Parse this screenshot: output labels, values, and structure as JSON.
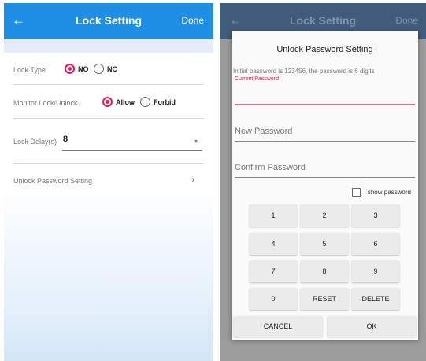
{
  "left_screen": {
    "appbar": {
      "back_icon": "arrow-left-icon",
      "back_glyph": "←",
      "title": "Lock Setting",
      "done_label": "Done",
      "color": "#1f8ee5"
    },
    "lock_type": {
      "label": "Lock Type",
      "options": [
        "NO",
        "NC"
      ],
      "selected": "NO"
    },
    "monitor": {
      "label": "Monitor Lock/Unlock",
      "options": [
        "Allow",
        "Forbid"
      ],
      "selected": "Allow"
    },
    "lock_delay": {
      "label": "Lock Delay(s)",
      "value": "8",
      "dropdown_glyph": "▾"
    },
    "unlock_password": {
      "label": "Unlock Password Setting",
      "chevron_glyph": "›"
    }
  },
  "right_screen": {
    "appbar": {
      "back_glyph": "←",
      "title": "Lock Setting",
      "done_label": "Done"
    },
    "dialog": {
      "title": "Unlock Password Setting",
      "info": "Initial password is 123456, the password is 6 digits",
      "current_label": "Current Password",
      "current_value": "",
      "new_placeholder": "New Password",
      "confirm_placeholder": "Confirm Password",
      "show_password_label": "show password",
      "keypad": [
        "1",
        "2",
        "3",
        "4",
        "5",
        "6",
        "7",
        "8",
        "9",
        "0",
        "RESET",
        "DELETE"
      ],
      "cancel_label": "CANCEL",
      "ok_label": "OK"
    }
  },
  "accent_color": "#e81c5a"
}
